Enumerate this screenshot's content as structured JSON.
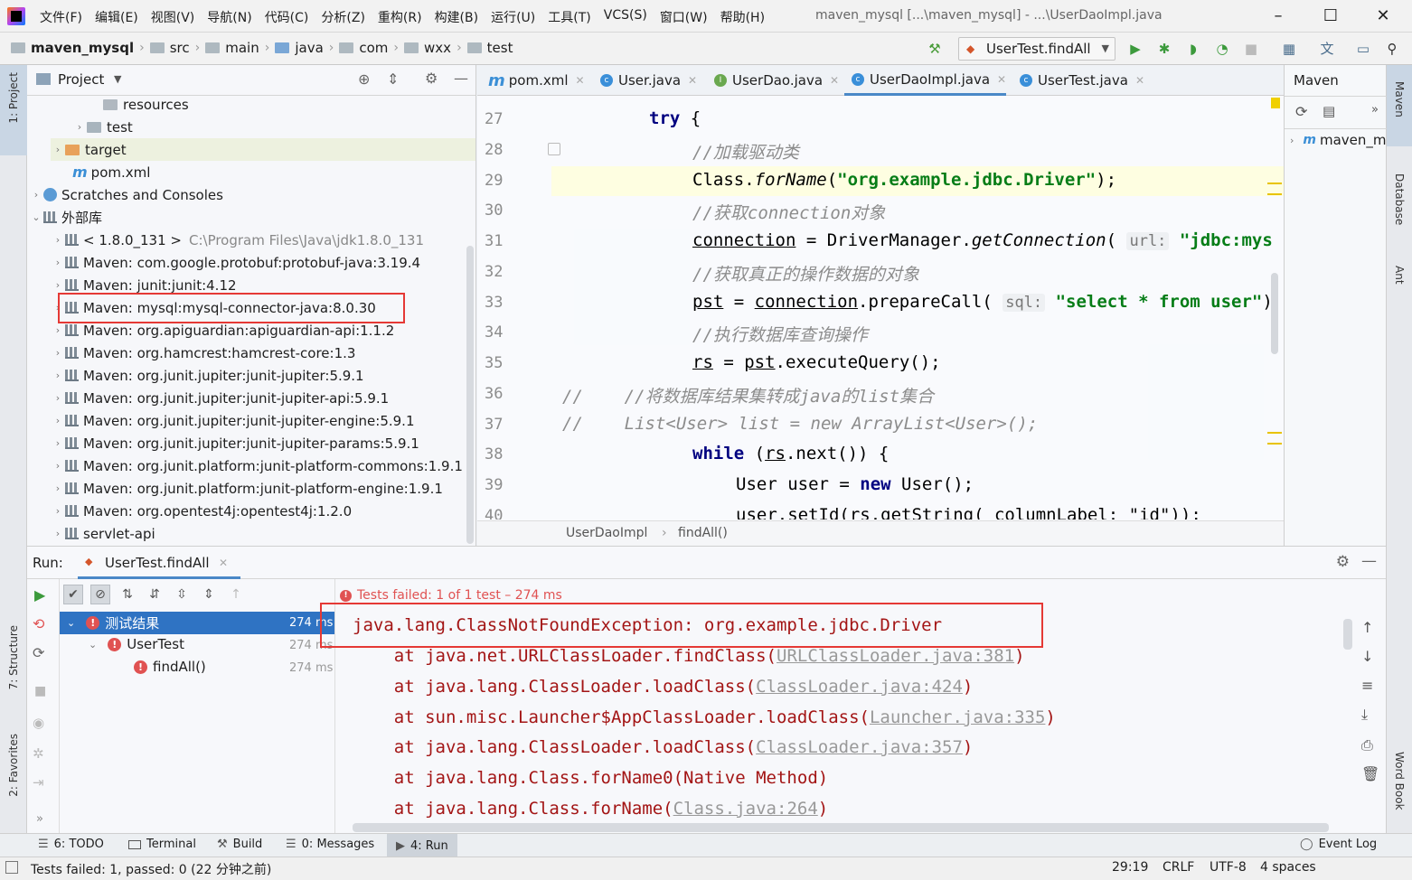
{
  "menubar": {
    "items": [
      "文件(F)",
      "编辑(E)",
      "视图(V)",
      "导航(N)",
      "代码(C)",
      "分析(Z)",
      "重构(R)",
      "构建(B)",
      "运行(U)",
      "工具(T)",
      "VCS(S)",
      "窗口(W)",
      "帮助(H)"
    ],
    "title": "maven_mysql [...\\maven_mysql] - ...\\UserDaoImpl.java"
  },
  "navbar": {
    "crumbs": [
      "maven_mysql",
      "src",
      "main",
      "java",
      "com",
      "wxx",
      "test"
    ],
    "run_config": "UserTest.findAll"
  },
  "left_stripe": {
    "project": "1: Project",
    "structure": "7: Structure",
    "favorites": "2: Favorites"
  },
  "right_stripe": {
    "maven": "Maven",
    "database": "Database",
    "ant": "Ant",
    "wordbook": "Word Book"
  },
  "project": {
    "title": "Project",
    "items": [
      {
        "label": "resources"
      },
      {
        "label": "test"
      },
      {
        "label": "target"
      },
      {
        "label": "pom.xml"
      },
      {
        "label": "Scratches and Consoles"
      },
      {
        "label": "外部库"
      },
      {
        "label": "< 1.8.0_131 >",
        "hint": "C:\\Program Files\\Java\\jdk1.8.0_131"
      },
      {
        "label": "Maven: com.google.protobuf:protobuf-java:3.19.4"
      },
      {
        "label": "Maven: junit:junit:4.12"
      },
      {
        "label": "Maven: mysql:mysql-connector-java:8.0.30"
      },
      {
        "label": "Maven: org.apiguardian:apiguardian-api:1.1.2"
      },
      {
        "label": "Maven: org.hamcrest:hamcrest-core:1.3"
      },
      {
        "label": "Maven: org.junit.jupiter:junit-jupiter:5.9.1"
      },
      {
        "label": "Maven: org.junit.jupiter:junit-jupiter-api:5.9.1"
      },
      {
        "label": "Maven: org.junit.jupiter:junit-jupiter-engine:5.9.1"
      },
      {
        "label": "Maven: org.junit.jupiter:junit-jupiter-params:5.9.1"
      },
      {
        "label": "Maven: org.junit.platform:junit-platform-commons:1.9.1"
      },
      {
        "label": "Maven: org.junit.platform:junit-platform-engine:1.9.1"
      },
      {
        "label": "Maven: org.opentest4j:opentest4j:1.2.0"
      },
      {
        "label": "servlet-api"
      }
    ]
  },
  "editor": {
    "tabs": [
      "pom.xml",
      "User.java",
      "UserDao.java",
      "UserDaoImpl.java",
      "UserTest.java"
    ],
    "line_numbers": [
      "27",
      "28",
      "29",
      "30",
      "31",
      "32",
      "33",
      "34",
      "35",
      "36",
      "37",
      "38",
      "39",
      "40"
    ],
    "code": {
      "l27_kw": "try",
      "l27_rest": " {",
      "l28": "//加载驱动类",
      "l29_a": "Class.",
      "l29_b": "forName",
      "l29_c": "(",
      "l29_str": "\"org.example.jdbc.Driver\"",
      "l29_d": ");",
      "l30": "//获取connection对象",
      "l31_a": "connection",
      "l31_b": " = DriverManager.",
      "l31_c": "getConnection",
      "l31_d": "( ",
      "l31_hint": "url:",
      "l31_str": " \"jdbc:mys",
      "l32": "//获取真正的操作数据的对象",
      "l33_a": "pst",
      "l33_b": " = ",
      "l33_c": "connection",
      "l33_d": ".prepareCall( ",
      "l33_hint": "sql:",
      "l33_str": " \"select * from user\"",
      "l33_e": ")",
      "l34": "//执行数据库查询操作",
      "l35_a": "rs",
      "l35_b": " = ",
      "l35_c": "pst",
      "l35_d": ".executeQuery();",
      "l36": "//    //将数据库结果集转成java的list集合",
      "l37": "//    List<User> list = new ArrayList<User>();",
      "l38_kw": "while",
      "l38_a": " (",
      "l38_b": "rs",
      "l38_c": ".next()) {",
      "l39_a": "User user = ",
      "l39_kw": "new",
      "l39_b": " User();",
      "l40": "user.setId(rs.getString( columnLabel: \"id\"));"
    },
    "breadcrumb": [
      "UserDaoImpl",
      "findAll()"
    ]
  },
  "maven_panel": {
    "title": "Maven",
    "project": "maven_m"
  },
  "run": {
    "label": "Run:",
    "tab": "UserTest.findAll",
    "summary": "Tests failed: 1 of 1 test – 274 ms",
    "tree": [
      {
        "label": "测试结果",
        "time": "274 ms"
      },
      {
        "label": "UserTest",
        "time": "274 ms"
      },
      {
        "label": "findAll()",
        "time": "274 ms"
      }
    ],
    "console": [
      {
        "text": "java.lang.ClassNotFoundException: org.example.jdbc.Driver"
      },
      {
        "pre": "    at java.net.URLClassLoader.findClass(",
        "link": "URLClassLoader.java:381",
        "post": ")"
      },
      {
        "pre": "    at java.lang.ClassLoader.loadClass(",
        "link": "ClassLoader.java:424",
        "post": ")"
      },
      {
        "pre": "    at sun.misc.Launcher$AppClassLoader.loadClass(",
        "link": "Launcher.java:335",
        "post": ")"
      },
      {
        "pre": "    at java.lang.ClassLoader.loadClass(",
        "link": "ClassLoader.java:357",
        "post": ")"
      },
      {
        "pre": "    at java.lang.Class.forName0(Native Method)",
        "link": "",
        "post": ""
      },
      {
        "pre": "    at java.lang.Class.forName(",
        "link": "Class.java:264",
        "post": ")"
      }
    ]
  },
  "toolwindows": {
    "todo": "6: TODO",
    "terminal": "Terminal",
    "build": "Build",
    "messages": "0: Messages",
    "run": "4: Run",
    "eventlog": "Event Log"
  },
  "status": {
    "message": "Tests failed: 1, passed: 0 (22 分钟之前)",
    "position": "29:19",
    "line_sep": "CRLF",
    "encoding": "UTF-8",
    "indent": "4 spaces"
  },
  "colors": {
    "accent": "#4a88c7",
    "error": "#e53935",
    "string": "#067d17",
    "keyword": "#000080"
  }
}
